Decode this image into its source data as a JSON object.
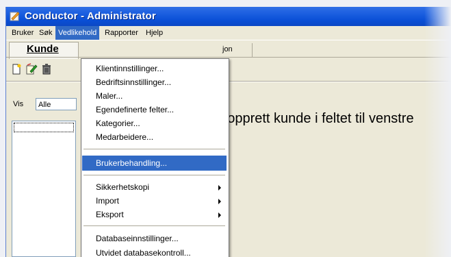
{
  "window": {
    "title": "Conductor - Administrator"
  },
  "menubar": {
    "items": [
      {
        "label": "Bruker",
        "active": false
      },
      {
        "label": "Søk",
        "active": false
      },
      {
        "label": "Vedlikehold",
        "active": true
      },
      {
        "label": "Rapporter",
        "active": false
      },
      {
        "label": "Hjelp",
        "active": false
      }
    ]
  },
  "tabs": {
    "left_label": "Kunde",
    "right_label": "jon"
  },
  "toolbar": {
    "icons": [
      "new-document-icon",
      "edit-icon",
      "delete-icon"
    ]
  },
  "filter": {
    "label": "Vis",
    "value": "Alle"
  },
  "hint": {
    "text": "r opprett kunde i feltet til venstre"
  },
  "dropdown": {
    "items": [
      {
        "label": "Klientinnstillinger...",
        "submenu": false
      },
      {
        "label": "Bedriftsinnstillinger...",
        "submenu": false
      },
      {
        "label": "Maler...",
        "submenu": false
      },
      {
        "label": "Egendefinerte felter...",
        "submenu": false
      },
      {
        "label": "Kategorier...",
        "submenu": false
      },
      {
        "label": "Medarbeidere...",
        "submenu": false
      },
      {
        "label": "Brukerbehandling...",
        "submenu": false,
        "highlighted": true
      },
      {
        "label": "Sikkerhetskopi",
        "submenu": true
      },
      {
        "label": "Import",
        "submenu": true
      },
      {
        "label": "Eksport",
        "submenu": true
      },
      {
        "label": "Databaseinnstillinger...",
        "submenu": false
      },
      {
        "label": "Utvidet databasekontroll...",
        "submenu": false
      }
    ]
  },
  "colors": {
    "titlebar": "#0a4fd6",
    "highlight": "#316ac5",
    "face": "#ece9d8"
  }
}
